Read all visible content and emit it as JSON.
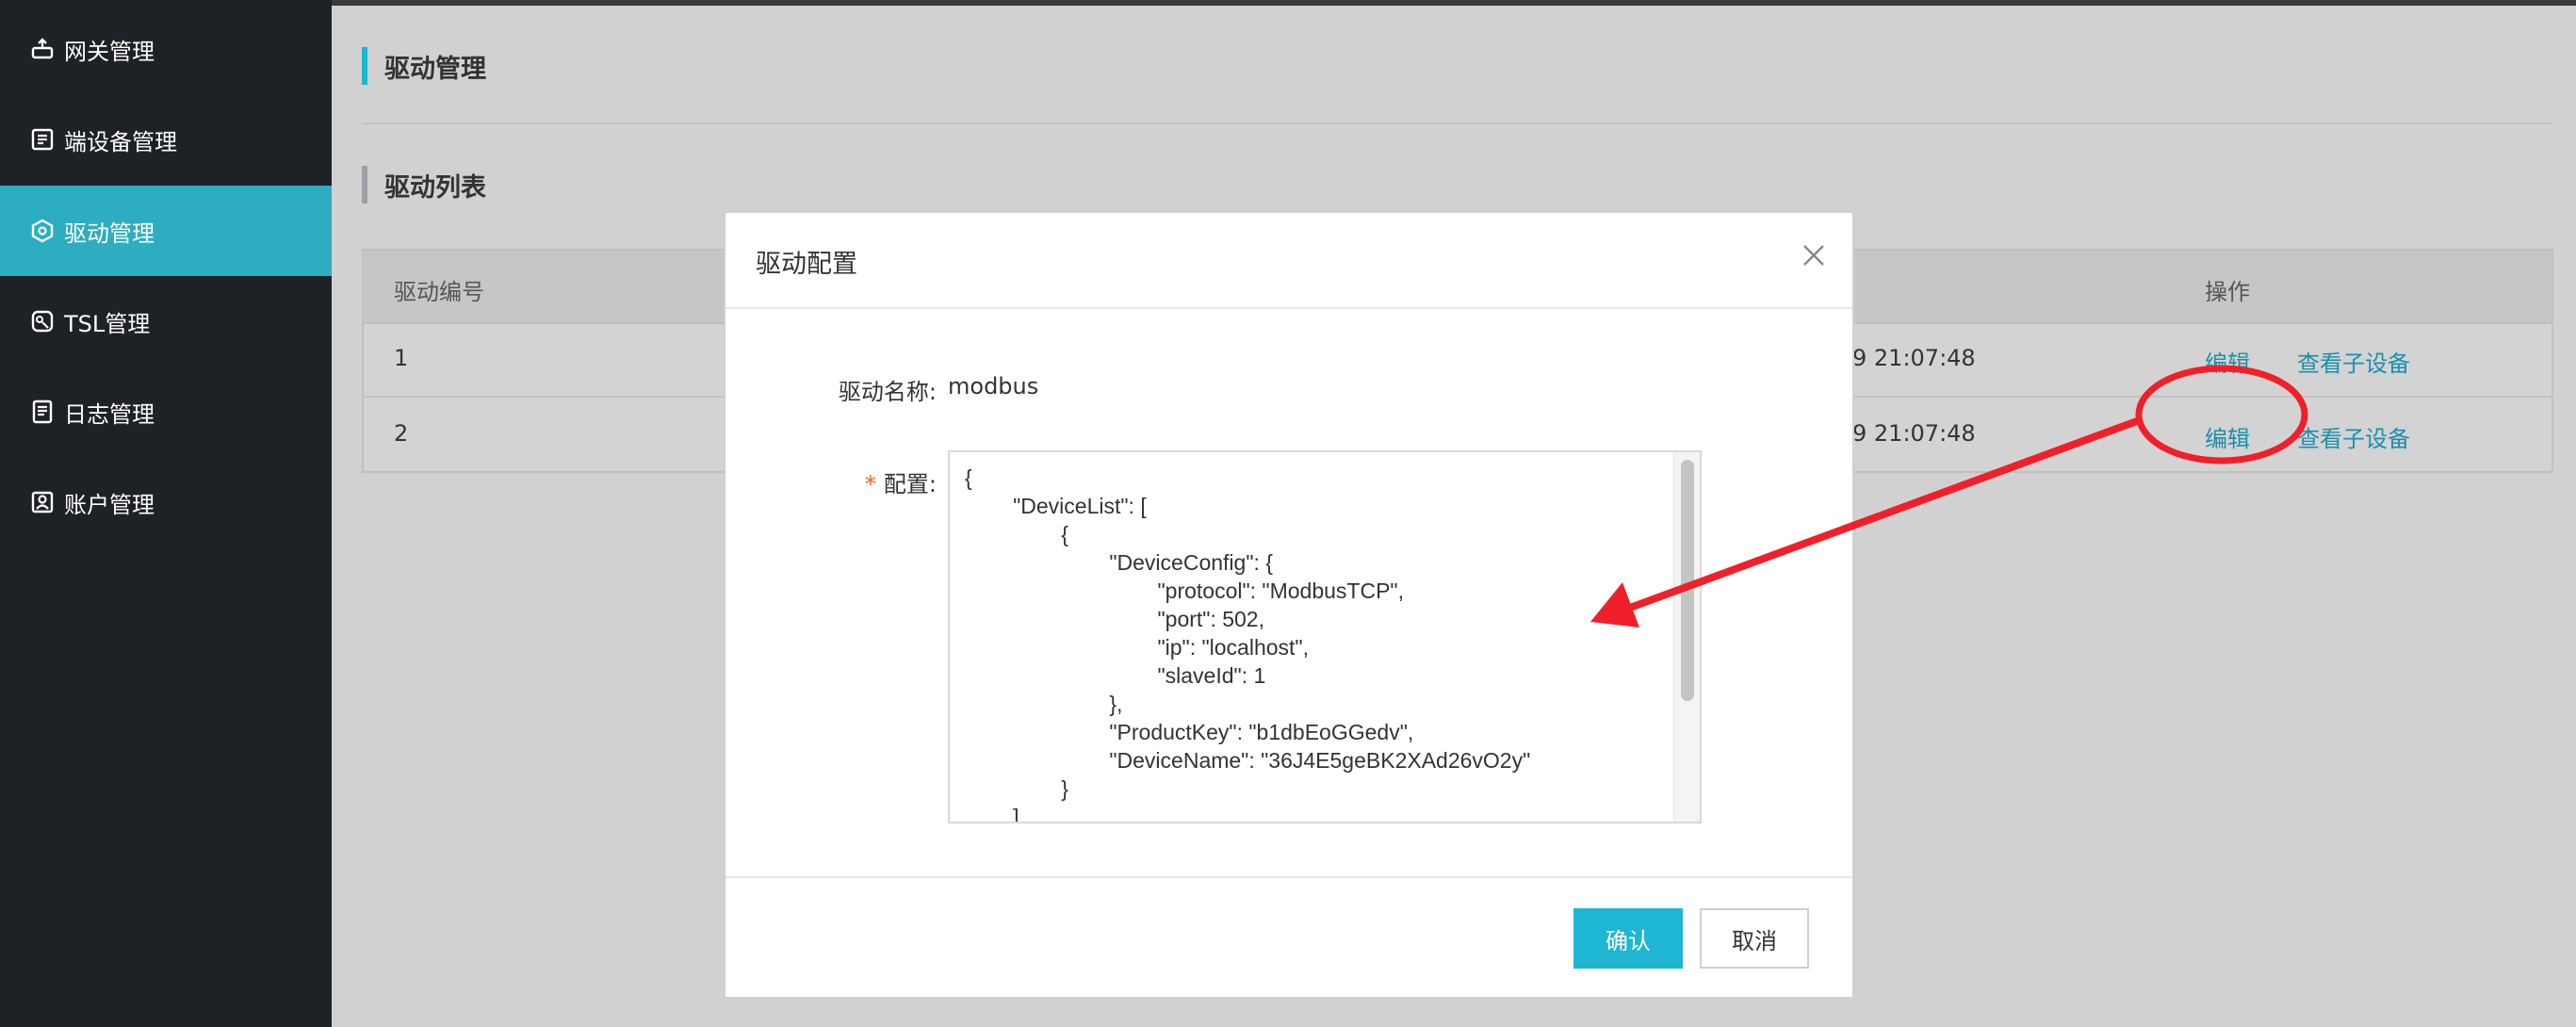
{
  "sidebar": {
    "items": [
      {
        "label": "网关管理",
        "icon": "gateway-icon"
      },
      {
        "label": "端设备管理",
        "icon": "device-list-icon"
      },
      {
        "label": "驱动管理",
        "icon": "driver-icon",
        "active": true
      },
      {
        "label": "TSL管理",
        "icon": "tsl-icon"
      },
      {
        "label": "日志管理",
        "icon": "log-icon"
      },
      {
        "label": "账户管理",
        "icon": "account-icon"
      }
    ]
  },
  "page": {
    "title": "驱动管理",
    "list_title": "驱动列表"
  },
  "table": {
    "headers": {
      "id": "驱动编号",
      "actions": "操作"
    },
    "rows": [
      {
        "id": "1",
        "time": "9 21:07:48",
        "edit": "编辑",
        "view": "查看子设备"
      },
      {
        "id": "2",
        "time": "9 21:07:48",
        "edit": "编辑",
        "view": "查看子设备"
      }
    ]
  },
  "modal": {
    "title": "驱动配置",
    "name_label": "驱动名称:",
    "name_value": "modbus",
    "required_mark": "*",
    "config_label": "配置:",
    "config_value": "{\n        \"DeviceList\": [\n                {\n                        \"DeviceConfig\": {\n                                \"protocol\": \"ModbusTCP\",\n                                \"port\": 502,\n                                \"ip\": \"localhost\",\n                                \"slaveId\": 1\n                        },\n                        \"ProductKey\": \"b1dbEoGGedv\",\n                        \"DeviceName\": \"36J4E5geBK2XAd26vO2y\"\n                }\n        ]",
    "confirm_label": "确认",
    "cancel_label": "取消"
  },
  "colors": {
    "sidebar_bg": "#1e2125",
    "active_item": "#2dadc0",
    "primary_button": "#1eb6d3",
    "link": "#1b8fad",
    "annotation": "#f0202a"
  }
}
